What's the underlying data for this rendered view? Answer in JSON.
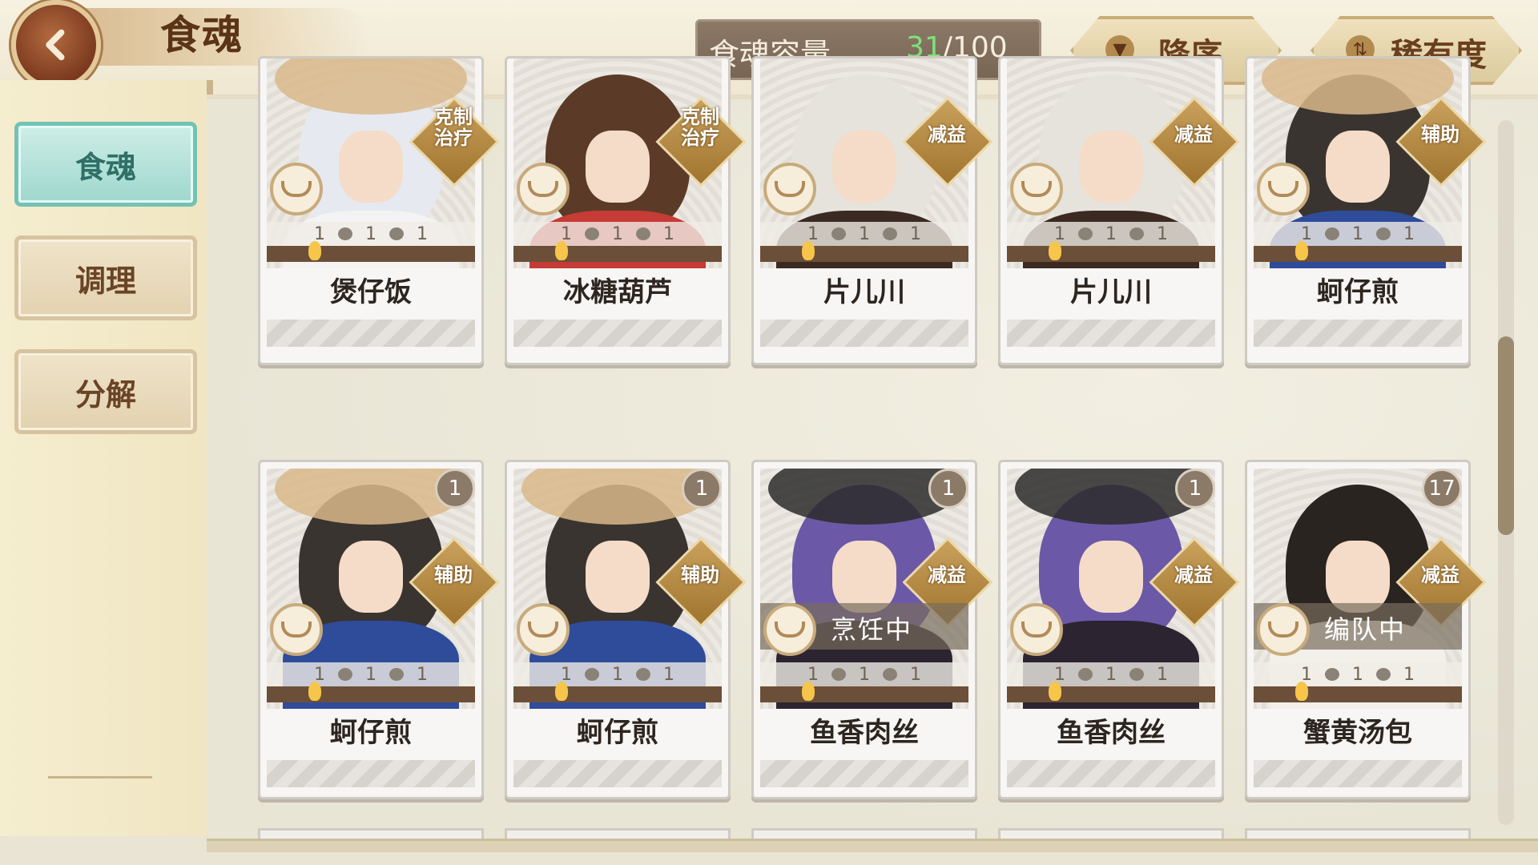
{
  "header": {
    "title": "食魂",
    "capacity_label": "食魂容量",
    "capacity_current": "31",
    "capacity_total": "/100",
    "sort_order_label": "降序",
    "rarity_label": "稀有度"
  },
  "sidebar": {
    "tabs": [
      {
        "label": "食魂",
        "active": true
      },
      {
        "label": "调理",
        "active": false
      },
      {
        "label": "分解",
        "active": false
      }
    ]
  },
  "colors": {
    "accent_teal": "#9fd7cd",
    "capacity_green": "#7fe07d",
    "role_gold": "#c9a15c"
  },
  "cards": [
    {
      "name": "煲仔饭",
      "role": "克制\n治疗",
      "level": "",
      "status": "",
      "stats": [
        "1",
        "1",
        "1"
      ],
      "hair": "#e7e9f0",
      "body": "#f3f3f3",
      "hat": "#d9b88a"
    },
    {
      "name": "冰糖葫芦",
      "role": "克制\n治疗",
      "level": "",
      "status": "",
      "stats": [
        "1",
        "1",
        "1"
      ],
      "hair": "#5b3b28",
      "body": "#c63b36",
      "hat": ""
    },
    {
      "name": "片儿川",
      "role": "减益",
      "level": "",
      "status": "",
      "stats": [
        "1",
        "1",
        "1"
      ],
      "hair": "#e5e3dc",
      "body": "#3b2a22",
      "hat": ""
    },
    {
      "name": "片儿川",
      "role": "减益",
      "level": "",
      "status": "",
      "stats": [
        "1",
        "1",
        "1"
      ],
      "hair": "#e5e3dc",
      "body": "#3b2a22",
      "hat": ""
    },
    {
      "name": "蚵仔煎",
      "role": "辅助",
      "level": "",
      "status": "",
      "stats": [
        "1",
        "1",
        "1"
      ],
      "hair": "#3a3430",
      "body": "#2f4c9a",
      "hat": "#d9b88a"
    },
    {
      "name": "蚵仔煎",
      "role": "辅助",
      "level": "1",
      "status": "",
      "stats": [
        "1",
        "1",
        "1"
      ],
      "hair": "#3a3430",
      "body": "#2f4c9a",
      "hat": "#d9b88a"
    },
    {
      "name": "蚵仔煎",
      "role": "辅助",
      "level": "1",
      "status": "",
      "stats": [
        "1",
        "1",
        "1"
      ],
      "hair": "#3a3430",
      "body": "#2f4c9a",
      "hat": "#d9b88a"
    },
    {
      "name": "鱼香肉丝",
      "role": "减益",
      "level": "1",
      "status": "烹饪中",
      "stats": [
        "1",
        "1",
        "1"
      ],
      "hair": "#6b58a6",
      "body": "#2c2430",
      "hat": "#2b2b2b"
    },
    {
      "name": "鱼香肉丝",
      "role": "减益",
      "level": "1",
      "status": "",
      "stats": [
        "1",
        "1",
        "1"
      ],
      "hair": "#6b58a6",
      "body": "#2c2430",
      "hat": "#2b2b2b"
    },
    {
      "name": "蟹黄汤包",
      "role": "减益",
      "level": "17",
      "status": "编队中",
      "stats": [
        "1",
        "1",
        "1"
      ],
      "hair": "#2a2420",
      "body": "#f3f0ea",
      "hat": ""
    }
  ]
}
